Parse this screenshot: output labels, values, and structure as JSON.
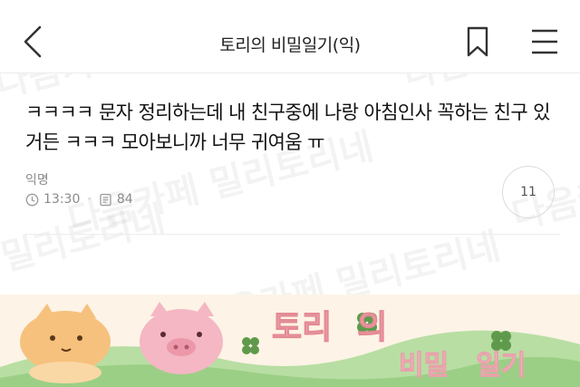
{
  "header": {
    "title": "토리의 비밀일기(익)",
    "back_icon": "chevron-left-icon",
    "bookmark_icon": "bookmark-icon",
    "menu_icon": "hamburger-menu-icon"
  },
  "post": {
    "body": "ㅋㅋㅋㅋ 문자 정리하는데 내 친구중에 나랑 아침인사 꼭하는 친구 있거든 ㅋㅋㅋ 모아보니까 너무 귀여움 ㅠ",
    "author": "익명",
    "time": "13:30",
    "views": "84",
    "comments": "11"
  },
  "watermark": "다음카페 밀리토리네",
  "banner": {
    "title_part1": "토리",
    "title_part2": "의",
    "subtitle_part1": "비밀",
    "subtitle_part2": "일기"
  },
  "colors": {
    "accent_pink": "#f3a6ad",
    "banner_green": "#9ccf86",
    "banner_bg": "#fdf3e6"
  }
}
